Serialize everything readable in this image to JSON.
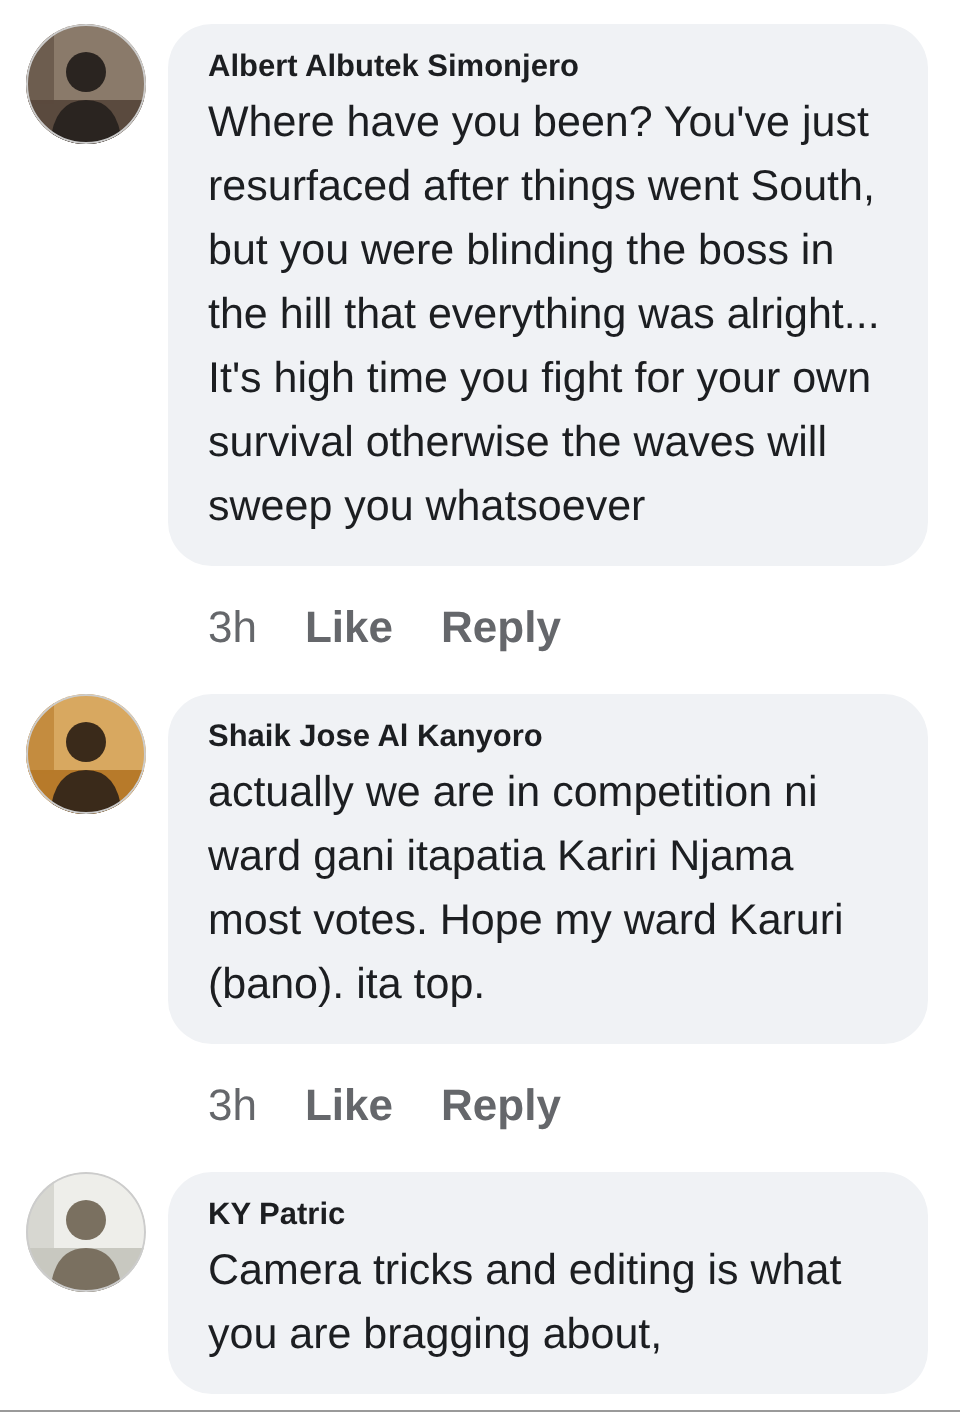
{
  "comments": [
    {
      "author": "Albert Albutek Simonjero",
      "avatar": {
        "kind": "picture"
      },
      "text": "Where have you been? You've just resurfaced after things went South, but you were blinding the boss in the hill that everything was alright... It's high time you fight for your own survival otherwise the waves will sweep you whatsoever",
      "time": "3h",
      "actions": [
        "Like",
        "Reply"
      ]
    },
    {
      "author": "Shaik Jose Al Kanyoro",
      "avatar": {
        "kind": "picture"
      },
      "text": "actually we are in competition ni ward gani itapatia Kariri Njama most votes. Hope my ward Karuri (bano). ita top.",
      "time": "3h",
      "actions": [
        "Like",
        "Reply"
      ]
    },
    {
      "author": "KY Patric",
      "avatar": {
        "kind": "picture"
      },
      "text": "Camera tricks and editing is what you are bragging about,"
    }
  ]
}
